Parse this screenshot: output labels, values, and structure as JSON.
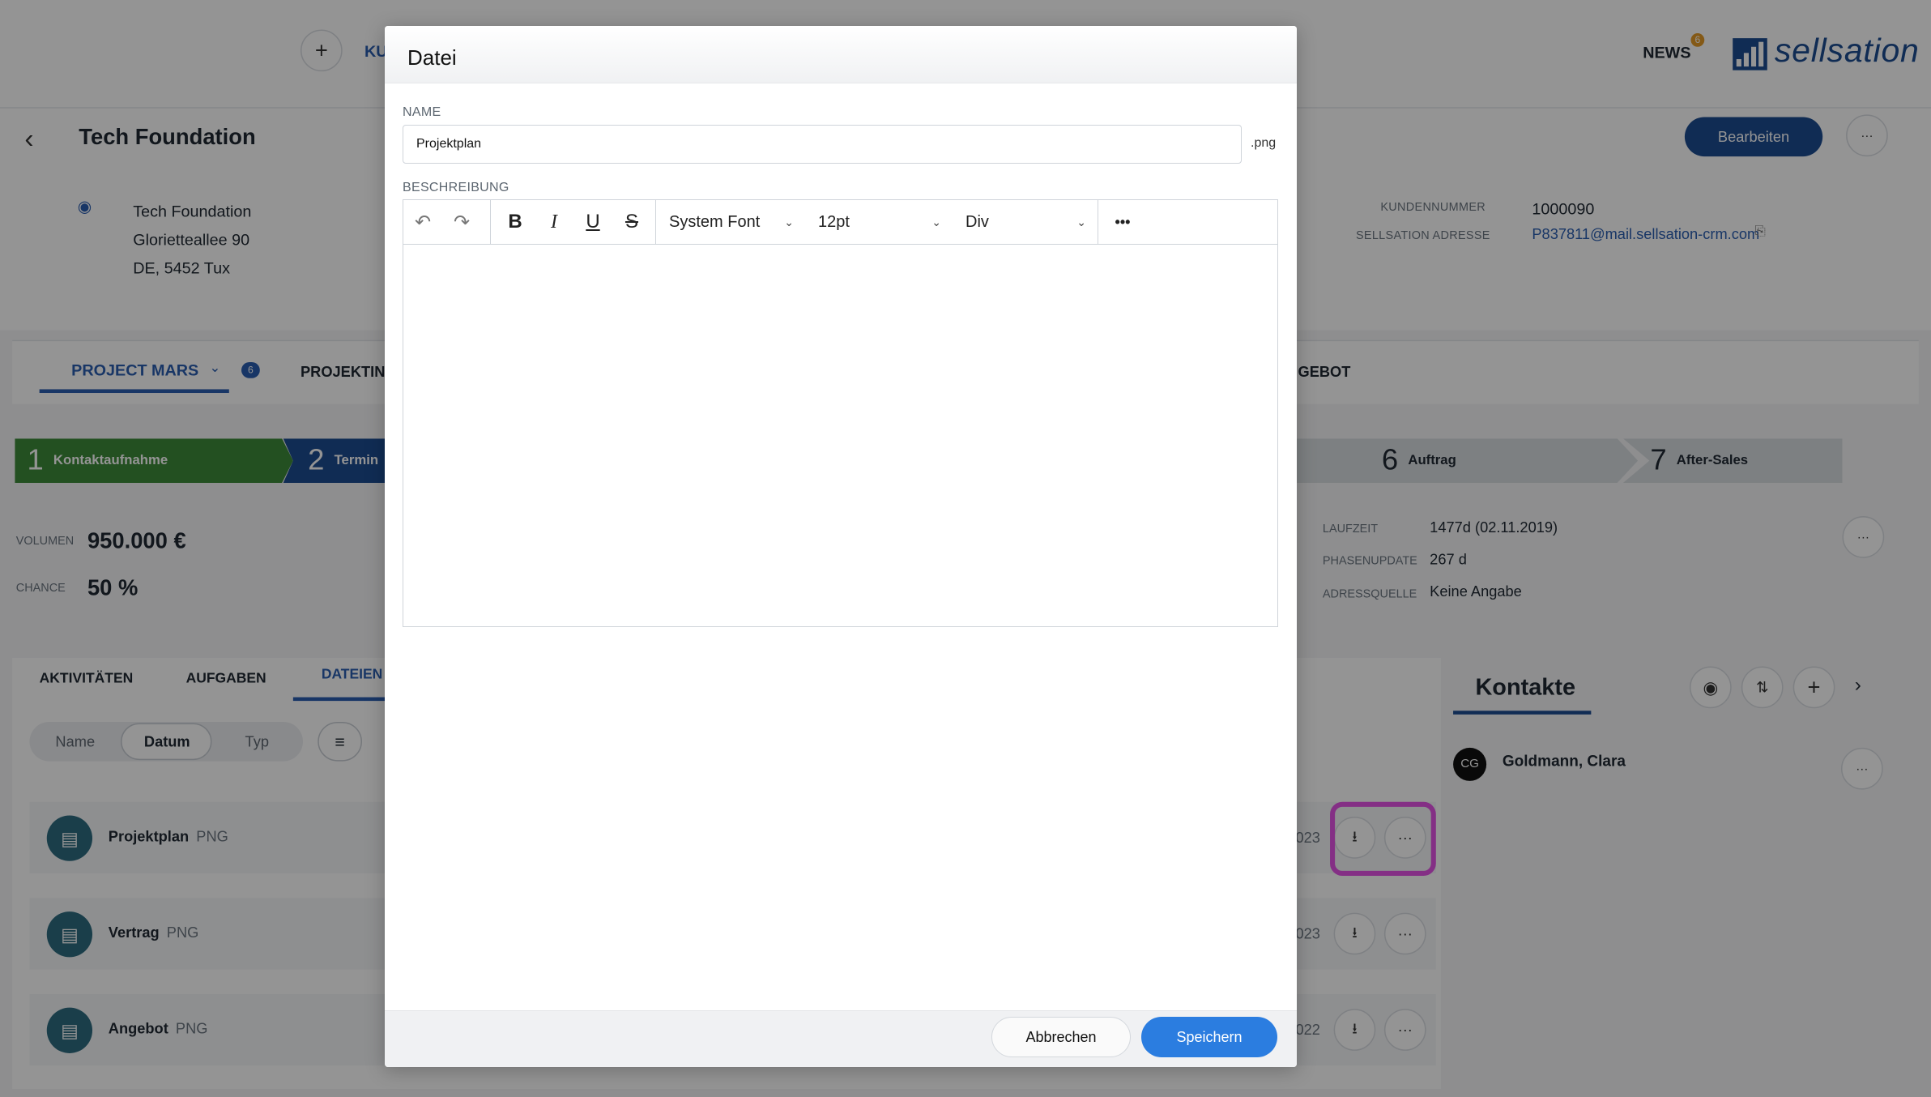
{
  "topbar": {
    "add_icon": "plus-icon",
    "nav_partial": "KU",
    "news_label": "NEWS",
    "news_count": "6",
    "logo_text": "sellsation"
  },
  "company": {
    "title": "Tech Foundation",
    "edit_label": "Bearbeiten",
    "more_label": "···",
    "address": [
      "Tech Foundation",
      "Glorietteallee 90",
      "DE, 5452 Tux"
    ],
    "customer_no_label": "KUNDENNUMMER",
    "customer_no": "1000090",
    "sellsation_address_label": "SELLSATION ADRESSE",
    "sellsation_address": "P837811@mail.sellsation-crm.com"
  },
  "project_tabs": {
    "project": "PROJECT MARS",
    "project_badge": "6",
    "projektinfo": "PROJEKTINF",
    "angebot": "GEBOT"
  },
  "phases": [
    {
      "num": "1",
      "label": "Kontaktaufnahme",
      "color": "#3d8a3a"
    },
    {
      "num": "2",
      "label": "Termin",
      "color": "#1d4c91"
    },
    {
      "num": "6",
      "label": "Auftrag",
      "color": "#d8dce1"
    },
    {
      "num": "7",
      "label": "After-Sales",
      "color": "#d8dce1"
    }
  ],
  "kpis": {
    "volume_label": "VOLUMEN",
    "volume": "950.000 €",
    "chance_label": "CHANCE",
    "chance": "50 %",
    "laufzeit_label": "LAUFZEIT",
    "laufzeit": "1477d (02.11.2019)",
    "phasenupdate_label": "PHASENUPDATE",
    "phasenupdate": "267 d",
    "adressquelle_label": "ADRESSQUELLE",
    "adressquelle": "Keine Angabe"
  },
  "lower_tabs": {
    "aktivitaeten": "AKTIVITÄTEN",
    "aufgaben": "AUFGABEN",
    "dateien": "DATEIEN"
  },
  "sort": {
    "name": "Name",
    "datum": "Datum",
    "typ": "Typ"
  },
  "files": [
    {
      "name": "Projektplan",
      "type": "PNG",
      "date": "023"
    },
    {
      "name": "Vertrag",
      "type": "PNG",
      "date": "023"
    },
    {
      "name": "Angebot",
      "type": "PNG",
      "date": "022"
    }
  ],
  "contacts": {
    "title": "Kontakte",
    "items": [
      {
        "initials": "CG",
        "name": "Goldmann, Clara"
      }
    ]
  },
  "modal": {
    "title": "Datei",
    "name_label": "NAME",
    "name_value": "Projektplan",
    "extension": ".png",
    "description_label": "BESCHREIBUNG",
    "toolbar": {
      "font": "System Font",
      "size": "12pt",
      "block": "Div",
      "more": "•••"
    },
    "cancel_label": "Abbrechen",
    "save_label": "Speichern"
  },
  "colors": {
    "accent": "#1d4c91",
    "save_button": "#2b7de0",
    "highlight": "#e451e6"
  }
}
